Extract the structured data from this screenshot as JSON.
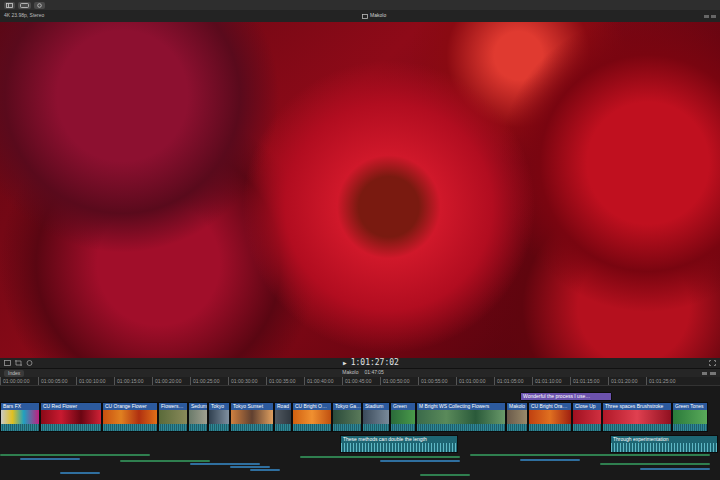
{
  "viewer": {
    "format": "4K 23.98p, Stereo",
    "project": "Makolo",
    "play_icon": "▶",
    "timecode": "1:01:27:02"
  },
  "timeline": {
    "index_label": "Index",
    "project": "Makolo",
    "duration": "01:47:05",
    "ruler": [
      "01:00:00:00",
      "01:00:05:00",
      "01:00:10:00",
      "01:00:15:00",
      "01:00:20:00",
      "01:00:25:00",
      "01:00:30:00",
      "01:00:35:00",
      "01:00:40:00",
      "01:00:45:00",
      "01:00:50:00",
      "01:00:55:00",
      "01:01:00:00",
      "01:01:05:00",
      "01:01:10:00",
      "01:01:15:00",
      "01:01:20:00",
      "01:01:25:00"
    ],
    "clips": [
      {
        "label": "Bars FX"
      },
      {
        "label": "CU Red Flower"
      },
      {
        "label": "CU Orange Flower"
      },
      {
        "label": "Flowers…"
      },
      {
        "label": "Sedum"
      },
      {
        "label": "Tokyo"
      },
      {
        "label": "Tokyo Sunset"
      },
      {
        "label": "Road"
      },
      {
        "label": "CU Bright O…"
      },
      {
        "label": "Tokyo Ga…"
      },
      {
        "label": "Stadium"
      },
      {
        "label": "Green"
      },
      {
        "label": "M Bright WS Collecting Flowers"
      },
      {
        "label": "Makolo"
      },
      {
        "label": "CU Bright Ora…"
      },
      {
        "label": "Close Up"
      },
      {
        "label": "Three spaces Brushstroke"
      },
      {
        "label": "Green Tones"
      }
    ],
    "titles": [
      {
        "label": "Wonderful the process I use…"
      }
    ],
    "audio": [
      {
        "label": "These methods can double the length"
      },
      {
        "label": "Through experimentation"
      }
    ]
  }
}
